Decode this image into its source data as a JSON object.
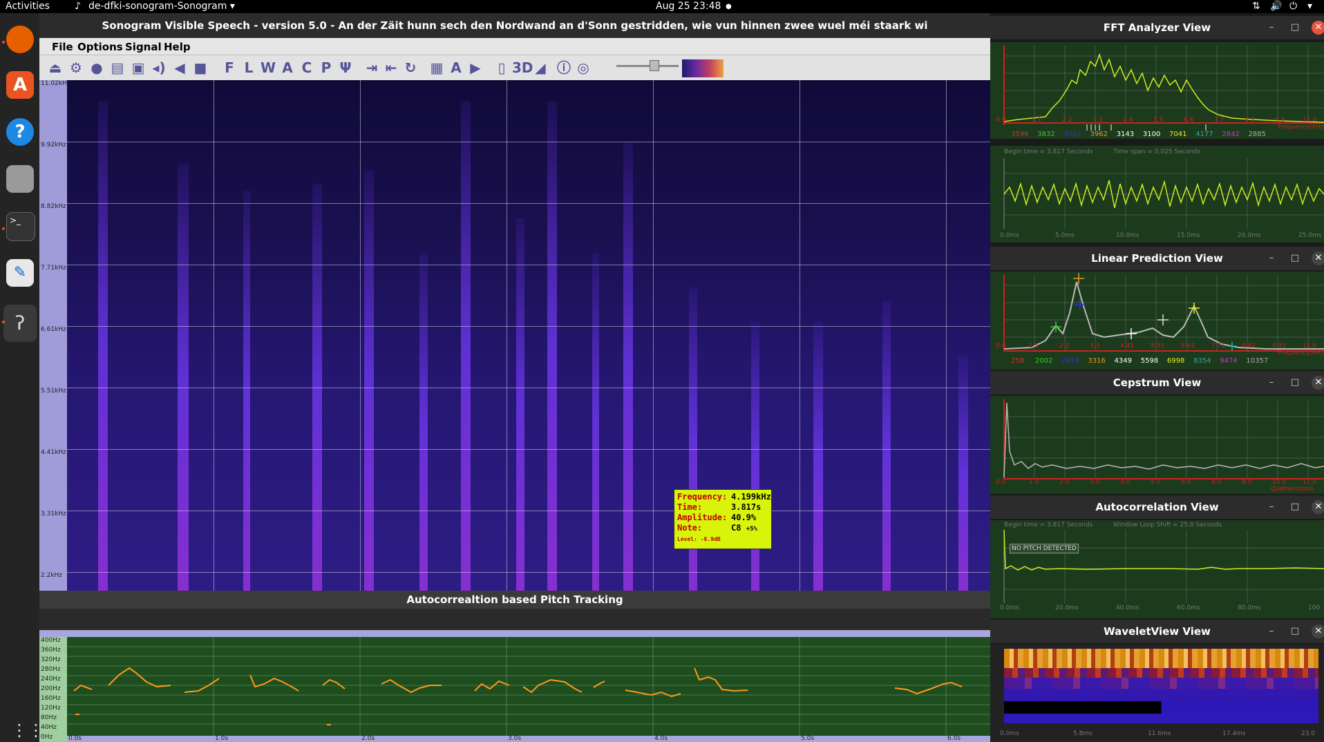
{
  "top_bar": {
    "activities": "Activities",
    "app_menu": "de-dfki-sonogram-Sonogram",
    "clock": "Aug 25  23:48"
  },
  "dock": {
    "apps": [
      {
        "name": "firefox-icon",
        "color": "#e66000"
      },
      {
        "name": "software-center-icon",
        "color": "#e95420"
      },
      {
        "name": "help-icon",
        "color": "#1e88e5"
      },
      {
        "name": "files-icon",
        "color": "#9a9a9a"
      },
      {
        "name": "terminal-icon",
        "color": "#333333"
      },
      {
        "name": "text-editor-icon",
        "color": "#e8e8e8"
      },
      {
        "name": "sonogram-ear-icon",
        "color": "#111111"
      }
    ]
  },
  "main_window": {
    "title": "Sonogram Visible Speech - version 5.0 - An der Zäit hunn sech den Nordwand an d'Sonn gestridden, wie vun hinnen zwee wuel méi staark wi",
    "menu": [
      "File",
      "Options",
      "Signal",
      "Help"
    ]
  },
  "sonogram": {
    "freq_labels": [
      "11.02kHz",
      "9.92kHz",
      "8.82kHz",
      "7.71kHz",
      "6.61kHz",
      "5.51kHz",
      "4.41kHz",
      "3.31kHz",
      "2.2kHz"
    ],
    "tooltip": {
      "rows": [
        {
          "label": "Frequency:",
          "value": "4.199kHz"
        },
        {
          "label": "Time:",
          "value": "3.817s"
        },
        {
          "label": "Amplitude:",
          "value": "40.9%"
        },
        {
          "label": "Note:",
          "value": "C8",
          "extra": "+5%"
        }
      ],
      "level": "Level: -8.9dB"
    }
  },
  "pitch": {
    "title": "Autocorrealtion based Pitch Tracking",
    "freq_labels": [
      "400Hz",
      "360Hz",
      "320Hz",
      "280Hz",
      "240Hz",
      "200Hz",
      "160Hz",
      "120Hz",
      "80Hz",
      "40Hz",
      "0Hz"
    ],
    "time_labels": [
      "0.0s",
      "1.0s",
      "2.0s",
      "3.0s",
      "4.0s",
      "5.0s",
      "6.0s"
    ]
  },
  "panels": {
    "fft": {
      "title": "FFT Analyzer View",
      "freq_labels": [
        "0.0",
        "1.1",
        "2.2",
        "3.3",
        "4.4",
        "5.5",
        "6.6",
        "7.7",
        "8.8",
        "9.9",
        "11.0"
      ],
      "axis_label": "Frequency(kHz)",
      "peak_values": [
        {
          "v": "3596",
          "c": "#cc3333"
        },
        {
          "v": "3832",
          "c": "#33cc33"
        },
        {
          "v": "4001",
          "c": "#3333cc"
        },
        {
          "v": "3962",
          "c": "#ee9922"
        },
        {
          "v": "3143",
          "c": "#ffffff"
        },
        {
          "v": "3100",
          "c": "#ffffff"
        },
        {
          "v": "7041",
          "c": "#eeee22"
        },
        {
          "v": "4177",
          "c": "#33aaaa"
        },
        {
          "v": "2842",
          "c": "#cc33cc"
        },
        {
          "v": "2885",
          "c": "#aaaaaa"
        }
      ]
    },
    "waveform": {
      "begin": "Begin time = 3.817 Seconds",
      "span": "Time span = 0.025 Seconds",
      "time_labels": [
        "0.0ms",
        "5.0ms",
        "10.0ms",
        "15.0ms",
        "20.0ms",
        "25.0ms"
      ]
    },
    "lpc": {
      "title": "Linear Prediction View",
      "freq_labels": [
        "0.0",
        "1.1",
        "2.2",
        "3.3",
        "4.41",
        "5.51",
        "6.61",
        "7.71",
        "8.82",
        "9.92",
        "11.0"
      ],
      "axis_label": "Frequency(kHz)",
      "peak_values": [
        {
          "v": "258",
          "c": "#cc3333"
        },
        {
          "v": "2002",
          "c": "#33cc33"
        },
        {
          "v": "2818",
          "c": "#3333cc"
        },
        {
          "v": "3316",
          "c": "#ee9922"
        },
        {
          "v": "4349",
          "c": "#ffffff"
        },
        {
          "v": "5598",
          "c": "#ffffff"
        },
        {
          "v": "6998",
          "c": "#eeee22"
        },
        {
          "v": "8354",
          "c": "#33aaaa"
        },
        {
          "v": "9474",
          "c": "#cc33cc"
        },
        {
          "v": "10357",
          "c": "#aaaaaa"
        }
      ]
    },
    "cepstrum": {
      "title": "Cepstrum View",
      "labels": [
        "0.0",
        "1.0",
        "2.0",
        "3.0",
        "4.0",
        "5.0",
        "6.0",
        "8.0",
        "9.0",
        "10.0",
        "11.0"
      ],
      "axis_label": "Quefrenz(ms)"
    },
    "autocorr": {
      "title": "Autocorrelation View",
      "begin": "Begin time = 3.817 Seconds",
      "shift": "Window Loop Shift = 25.0 Seconds",
      "no_pitch": "NO PITCH DETECTED",
      "time_labels": [
        "0.0ms",
        "20.0ms",
        "40.0ms",
        "60.0ms",
        "80.0ms",
        "100"
      ]
    },
    "wavelet": {
      "title": "WaveletView View",
      "time_labels": [
        "0.0ms",
        "5.8ms",
        "11.6ms",
        "17.4ms",
        "23.0"
      ]
    }
  }
}
